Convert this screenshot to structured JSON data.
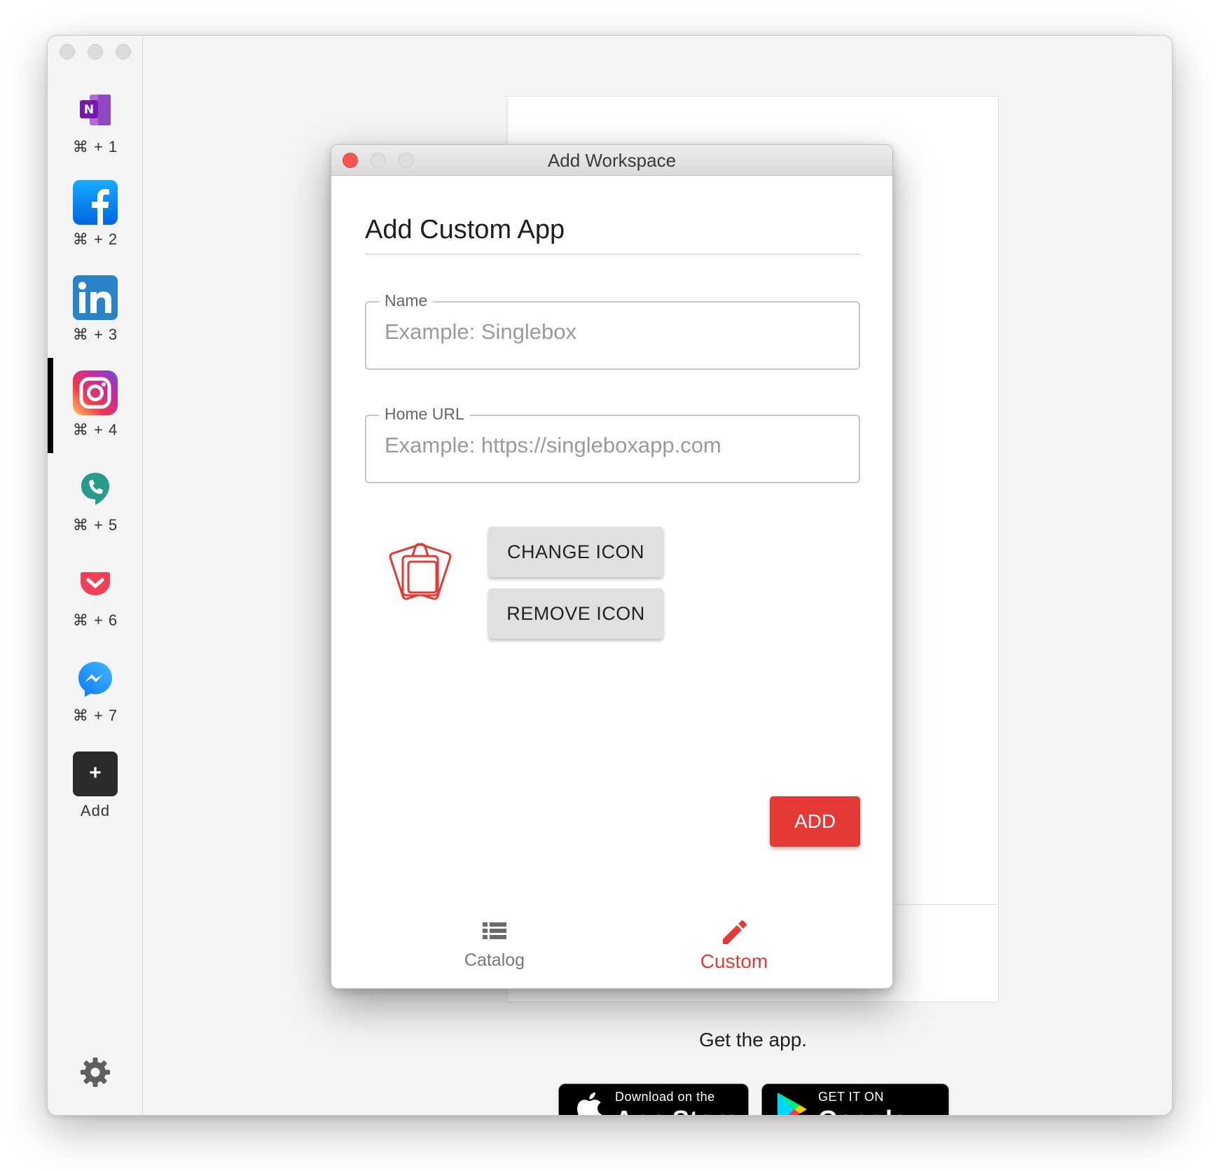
{
  "workspaces": [
    {
      "name": "onenote",
      "shortcut": "⌘ + 1"
    },
    {
      "name": "facebook",
      "shortcut": "⌘ + 2"
    },
    {
      "name": "linkedin",
      "shortcut": "⌘ + 3"
    },
    {
      "name": "instagram",
      "shortcut": "⌘ + 4"
    },
    {
      "name": "hangouts",
      "shortcut": "⌘ + 5"
    },
    {
      "name": "pocket",
      "shortcut": "⌘ + 6"
    },
    {
      "name": "messenger",
      "shortcut": "⌘ + 7"
    }
  ],
  "sidebar": {
    "add_symbol": "+",
    "add_label": "Add",
    "settings_icon": "gear-icon"
  },
  "background": {
    "get_app_text": "Get the app.",
    "apple_badge_small": "Download on the",
    "apple_badge_big": "App Store",
    "google_badge_small": "GET IT ON",
    "google_badge_big": "Google Play"
  },
  "dialog": {
    "window_title": "Add Workspace",
    "heading": "Add Custom App",
    "name_label": "Name",
    "name_placeholder": "Example: Singlebox",
    "url_label": "Home URL",
    "url_placeholder": "Example: https://singleboxapp.com",
    "change_icon_label": "CHANGE ICON",
    "remove_icon_label": "REMOVE ICON",
    "add_label": "ADD",
    "tabs": [
      {
        "label": "Catalog",
        "icon": "list-icon",
        "active": false
      },
      {
        "label": "Custom",
        "icon": "pencil-icon",
        "active": true
      }
    ]
  },
  "colors": {
    "accent": "#e53935",
    "close_button": "#fc5753"
  }
}
